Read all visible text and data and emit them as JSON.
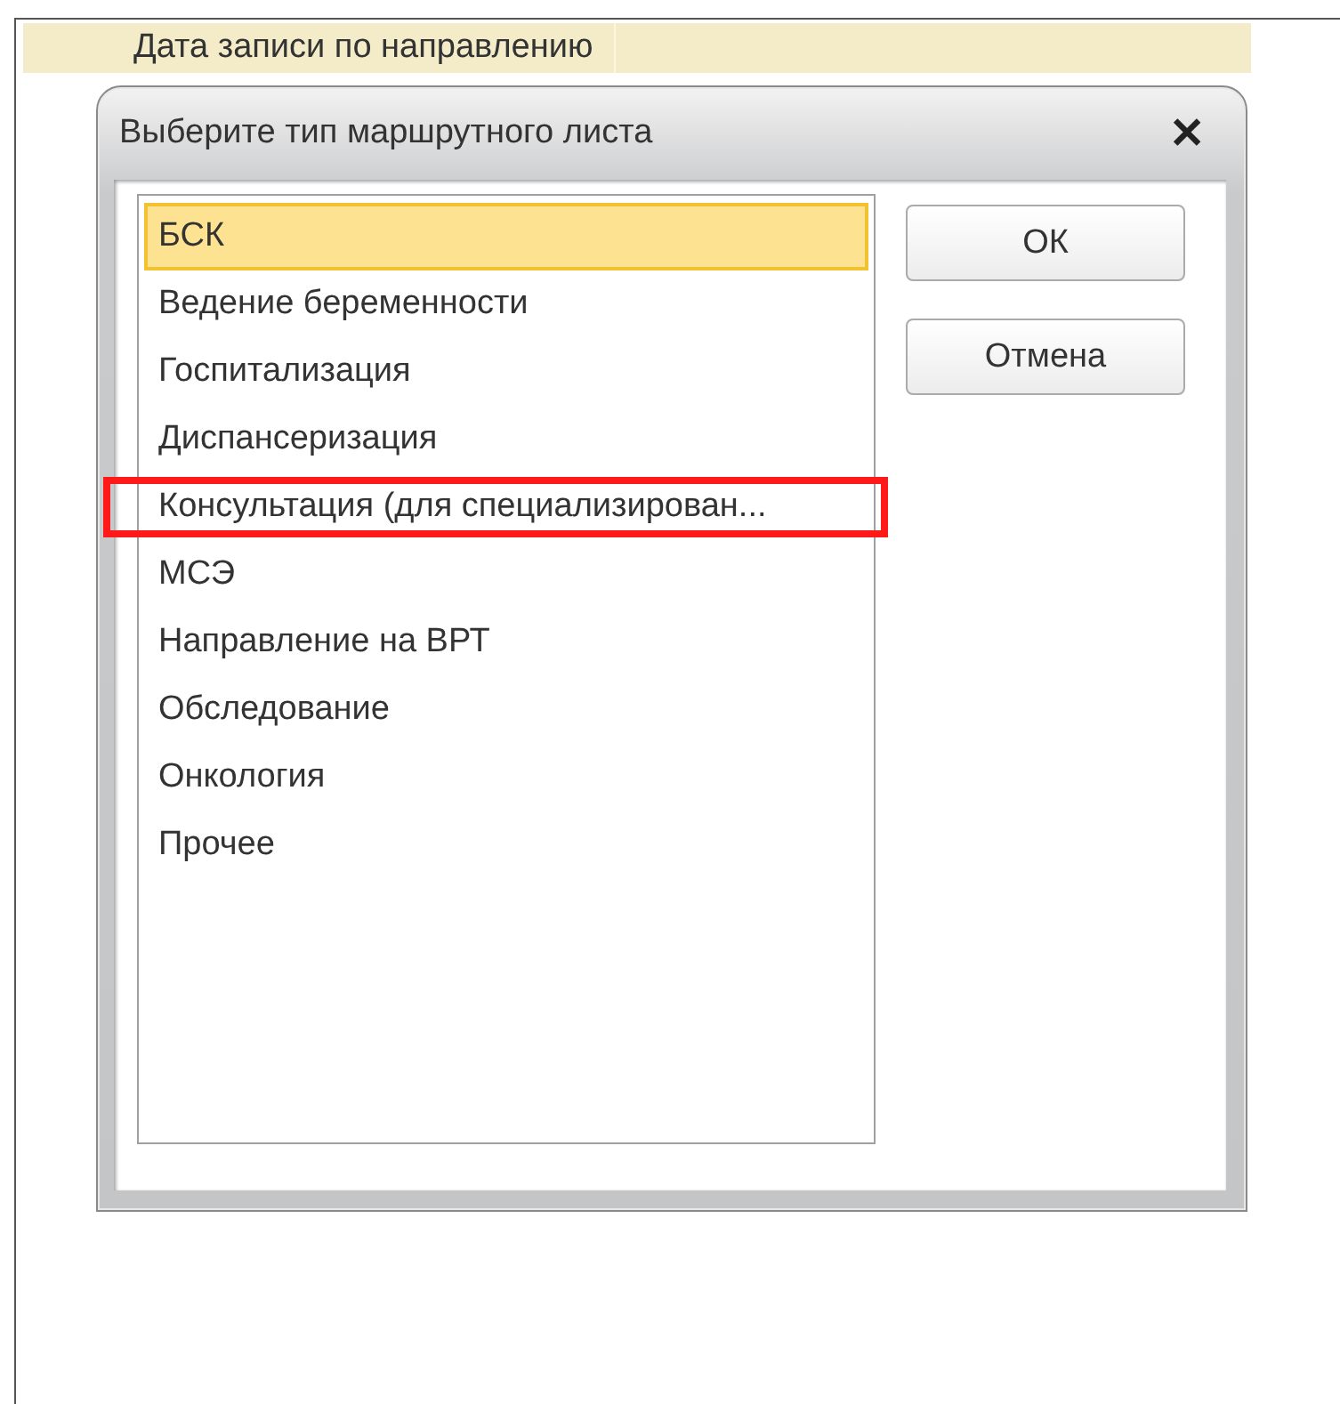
{
  "header": {
    "label": "Дата записи по направлению"
  },
  "dialog": {
    "title": "Выберите тип маршрутного листа",
    "close": "✕",
    "items": [
      {
        "label": "БСК",
        "selected": true,
        "annotated": false
      },
      {
        "label": "Ведение беременности",
        "selected": false,
        "annotated": false
      },
      {
        "label": "Госпитализация",
        "selected": false,
        "annotated": false
      },
      {
        "label": "Диспансеризация",
        "selected": false,
        "annotated": false
      },
      {
        "label": "Консультация (для специализирован...",
        "selected": false,
        "annotated": true
      },
      {
        "label": "МСЭ",
        "selected": false,
        "annotated": false
      },
      {
        "label": "Направление на ВРТ",
        "selected": false,
        "annotated": false
      },
      {
        "label": "Обследование",
        "selected": false,
        "annotated": false
      },
      {
        "label": "Онкология",
        "selected": false,
        "annotated": false
      },
      {
        "label": "Прочее",
        "selected": false,
        "annotated": false
      }
    ],
    "buttons": [
      "ОК",
      "Отмена"
    ]
  }
}
